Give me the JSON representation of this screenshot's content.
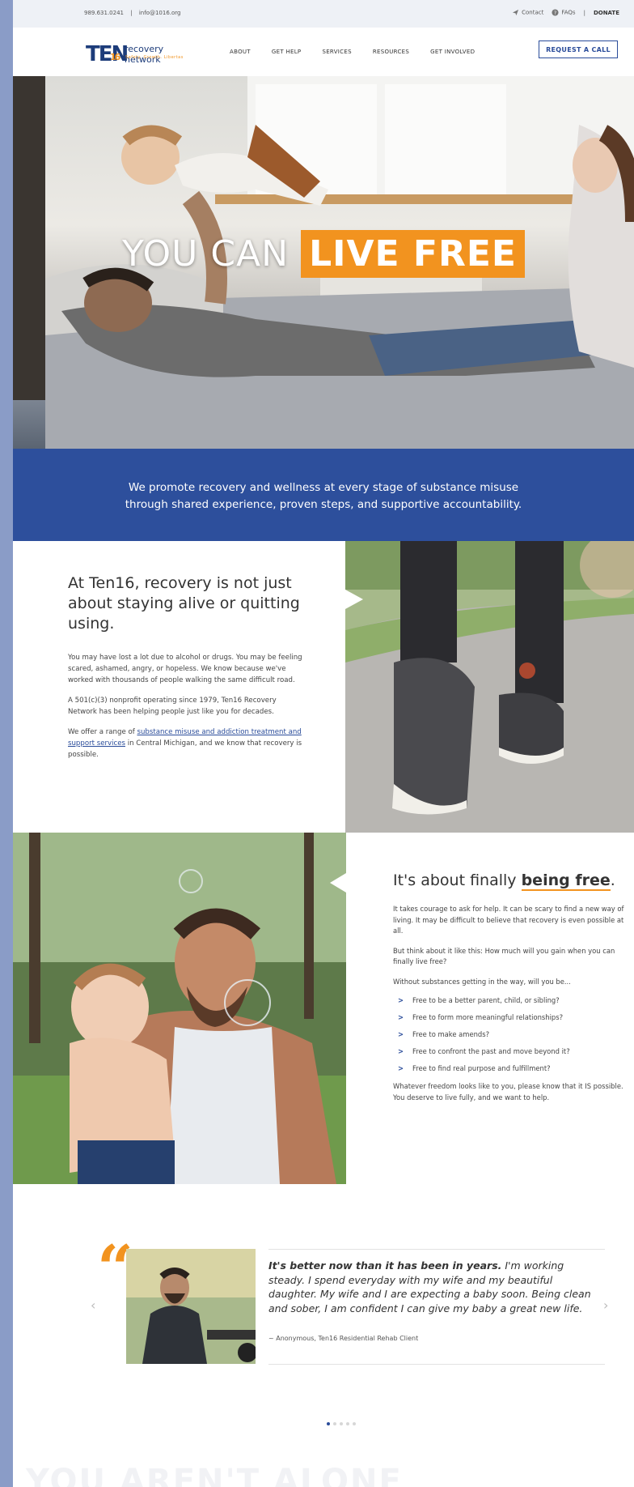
{
  "topbar": {
    "phone": "989.631.0241",
    "separator": "|",
    "email": "info@1016.org",
    "contact": "Contact",
    "faqs": "FAQs",
    "donate": "DONATE"
  },
  "nav": {
    "logo_mark": "TEN",
    "logo_mark_sub": "16",
    "logo_name": "recovery network",
    "logo_tagline": "Safety. Growth. Libertas",
    "items": [
      "ABOUT",
      "GET HELP",
      "SERVICES",
      "RESOURCES",
      "GET INVOLVED"
    ],
    "cta": "REQUEST A CALL"
  },
  "hero": {
    "title_plain": "YOU CAN",
    "title_highlight": "LIVE FREE"
  },
  "band": {
    "line1": "We promote recovery and wellness at every stage of substance misuse",
    "line2": "through shared experience, proven steps, and supportive accountability."
  },
  "section1": {
    "heading": "At Ten16, recovery is not just about staying alive or quitting using.",
    "p1": "You may have lost a lot due to alcohol or drugs. You may be feeling scared, ashamed, angry, or hopeless. We know because we've worked with thousands of people walking the same difficult road.",
    "p2": "A 501(c)(3) nonprofit operating since 1979, Ten16 Recovery Network has been helping people just like you for decades.",
    "p3_pre": "We offer a range of ",
    "p3_link": "substance misuse and addiction treatment and support services",
    "p3_post": " in Central Michigan, and we know that recovery is possible."
  },
  "section2": {
    "heading_pre": "It's about finally ",
    "heading_bold": "being free",
    "heading_post": ".",
    "p1": "It takes courage to ask for help. It can be scary to find a new way of living. It may be difficult to believe that recovery is even possible at all.",
    "p2": "But think about it like this: How much will you gain when you can finally live free?",
    "p3": "Without substances getting in the way, will you be...",
    "list": [
      "Free to be a better parent, child, or sibling?",
      "Free to form more meaningful relationships?",
      "Free to make amends?",
      "Free to confront the past and move beyond it?",
      "Free to find real purpose and fulfillment?"
    ],
    "p4": "Whatever freedom looks like to you, please know that it IS possible. You deserve to live fully, and we want to help."
  },
  "testimonial": {
    "quote_mark": "“",
    "lead": "It's better now than it has been in years.",
    "body": " I'm working steady. I spend everyday with my wife and my beautiful daughter. My wife and I are expecting a baby soon. Being clean and sober, I am confident I can give my baby a great new life.",
    "attribution": "~ Anonymous, Ten16 Residential Rehab Client",
    "prev": "‹",
    "next": "›",
    "slides": 5,
    "active_slide": 1
  },
  "ghost_heading": "YOU AREN'T ALONE",
  "icons": [
    "send-icon",
    "question-icon",
    "chevron-right-icon",
    "quote-icon"
  ],
  "colors": {
    "brand_blue": "#2d4f9c",
    "accent_orange": "#f2931f",
    "logo_navy": "#1d3c7a"
  }
}
